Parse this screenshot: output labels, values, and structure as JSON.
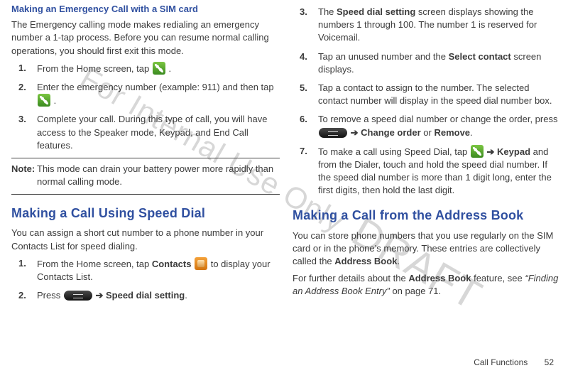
{
  "watermark": {
    "part1": "For Internal Use Only",
    "part2": "DRAFT",
    "part3": ""
  },
  "arrows": {
    "a": " ➔ "
  },
  "left": {
    "sub1": "Making an Emergency Call with a SIM card",
    "p1": "The Emergency calling mode makes redialing an emergency number a 1-tap process. Before you can resume normal calling operations, you should first exit this mode.",
    "steps1": [
      {
        "num": "1.",
        "pre": "From the Home screen, tap ",
        "post": " ."
      },
      {
        "num": "2.",
        "pre": "Enter the emergency number (example: 911) and then tap ",
        "post": " ."
      },
      {
        "num": "3.",
        "pre": "Complete your call. During this type of call, you will have access to the Speaker mode, Keypad, and End Call features."
      }
    ],
    "note": {
      "label": "Note:",
      "text": "This mode can drain your battery power more rapidly than normal calling mode."
    },
    "head2": "Making a Call Using Speed Dial",
    "p2": "You can assign a short cut number to a phone number in your Contacts List for speed dialing.",
    "steps2": [
      {
        "num": "1.",
        "pre": "From the Home screen, tap ",
        "b1": "Contacts ",
        "post": " to display your Contacts List."
      },
      {
        "num": "2.",
        "pre": "Press ",
        "b1": "Speed dial setting",
        "post": "."
      }
    ]
  },
  "right": {
    "steps": [
      {
        "num": "3.",
        "pre": "The ",
        "b1": "Speed dial setting",
        "post": " screen displays showing the numbers 1 through 100. The number 1 is reserved for Voicemail."
      },
      {
        "num": "4.",
        "pre": "Tap an unused number and the ",
        "b1": "Select contact",
        "post": " screen displays."
      },
      {
        "num": "5.",
        "pre": "Tap a contact to assign to the number. The selected contact number will display in the speed dial number box."
      },
      {
        "num": "6.",
        "pre": "To remove a speed dial number or change the order, press ",
        "b1": "Change order",
        "mid": " or ",
        "b2": "Remove",
        "post": "."
      },
      {
        "num": "7.",
        "pre": "To make a call using Speed Dial, tap ",
        "b1": "Keypad",
        "post": " and from the Dialer, touch and hold the speed dial number. If the speed dial number is more than 1 digit long, enter the first digits, then hold the last digit."
      }
    ],
    "head": "Making a Call from the Address Book",
    "p1": {
      "pre": "You can store phone numbers that you use regularly on the SIM card or in the phone’s memory. These entries are collectively called the ",
      "b1": "Address Book",
      "post": "."
    },
    "p2": {
      "pre": "For further details about the ",
      "b1": "Address Book",
      "mid": " feature, see ",
      "i1": "“Finding an Address Book Entry”",
      "post": " on page 71."
    }
  },
  "footer": {
    "section": "Call Functions",
    "page": "52"
  }
}
